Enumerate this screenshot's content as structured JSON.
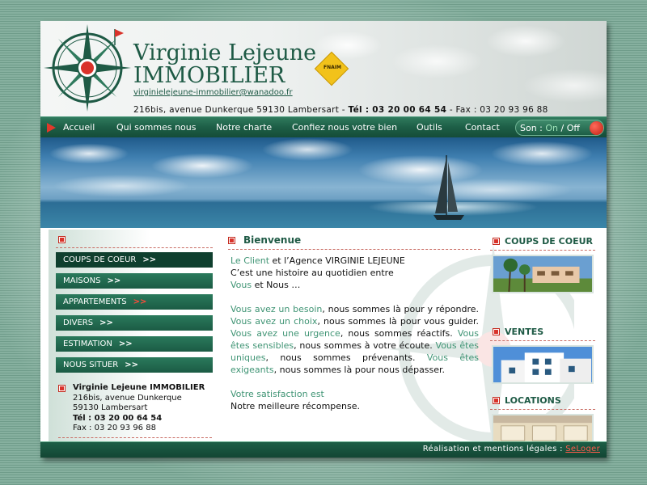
{
  "brand": {
    "name": "Virginie Lejeune",
    "subtitle": "IMMOBILIER",
    "badge": "FNAIM",
    "email": "virginielejeune-immobilier@wanadoo.fr",
    "address": "216bis, avenue Dunkerque 59130 Lambersart - ",
    "phone": "Tél : 03 20 00 64 54",
    "fax": " -  Fax : 03 20 93 96 88"
  },
  "nav": {
    "items": [
      "Accueil",
      "Qui sommes nous",
      "Notre charte",
      "Confiez nous votre bien",
      "Outils",
      "Contact"
    ],
    "sound_label": "Son : ",
    "sound_on": "On",
    "sound_sep": " / ",
    "sound_off": "Off"
  },
  "menu": [
    {
      "label": "COUPS DE COEUR",
      "arrows": ">>"
    },
    {
      "label": "MAISONS",
      "arrows": ">>"
    },
    {
      "label": "APPARTEMENTS",
      "arrows": ">>"
    },
    {
      "label": "DIVERS",
      "arrows": ">>"
    },
    {
      "label": "ESTIMATION",
      "arrows": ">>"
    },
    {
      "label": "NOUS SITUER",
      "arrows": ">>"
    }
  ],
  "contact": {
    "name": "Virginie Lejeune IMMOBILIER",
    "address1": "216bis, avenue Dunkerque",
    "address2": "59130 Lambersart",
    "phone": "Tél : 03 20 00 64 54",
    "fax": "Fax : 03 20 93 96 88"
  },
  "welcome": {
    "title": "Bienvenue",
    "p1_a": "Le Client",
    "p1_b": " et l’Agence VIRGINIE LEJEUNE",
    "p1_c": "C’est une histoire au quotidien entre",
    "p1_d": "Vous",
    "p1_e": " et Nous …",
    "p2_1": "Vous avez un besoin",
    "p2_2": ", nous sommes là pour y répondre. ",
    "p2_3": "Vous avez un choix",
    "p2_4": ", nous sommes là pour vous guider. ",
    "p2_5": "Vous avez une urgence",
    "p2_6": ", nous sommes réactifs. ",
    "p2_7": "Vous êtes sensibles",
    "p2_8": ", nous sommes à votre écoute. ",
    "p2_9": "Vous êtes uniques",
    "p2_10": ", nous sommes prévenants. ",
    "p2_11": "Vous êtes exigeants",
    "p2_12": ", nous sommes là pour nous dépasser.",
    "p3_a": "Votre satisfaction est",
    "p3_b": "Notre meilleure récompense."
  },
  "sidebar_right": {
    "sections": [
      "COUPS DE COEUR",
      "VENTES",
      "LOCATIONS"
    ]
  },
  "footer": {
    "text": "Réalisation et mentions légales : ",
    "link": "SeLoger"
  },
  "colors": {
    "brand_green": "#1e5a45",
    "accent_red": "#d9322a",
    "highlight_green": "#3f9474"
  }
}
